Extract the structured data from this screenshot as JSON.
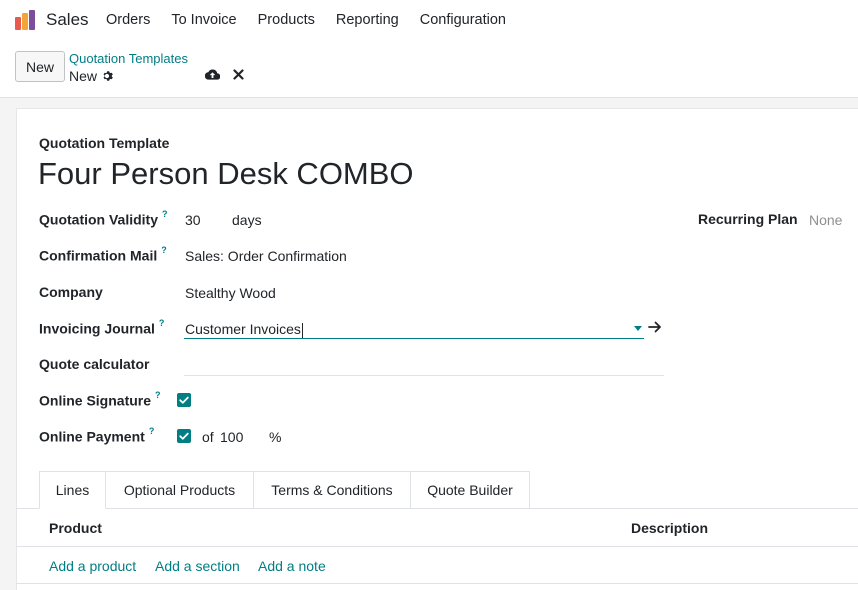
{
  "app": {
    "name": "Sales"
  },
  "nav": {
    "items": [
      "Orders",
      "To Invoice",
      "Products",
      "Reporting",
      "Configuration"
    ]
  },
  "control_panel": {
    "new_label": "New",
    "breadcrumb_parent": "Quotation Templates",
    "breadcrumb_current": "New"
  },
  "form": {
    "title_label": "Quotation Template",
    "title": "Four Person Desk COMBO",
    "fields": {
      "validity": {
        "label": "Quotation Validity",
        "help": "?",
        "value": "30",
        "unit": "days"
      },
      "recurring": {
        "label": "Recurring Plan",
        "value": "None"
      },
      "confirmation_mail": {
        "label": "Confirmation Mail",
        "help": "?",
        "value": "Sales: Order Confirmation"
      },
      "company": {
        "label": "Company",
        "value": "Stealthy Wood"
      },
      "invoicing_journal": {
        "label": "Invoicing Journal",
        "help": "?",
        "value": "Customer Invoices"
      },
      "quote_calculator": {
        "label": "Quote calculator",
        "value": ""
      },
      "online_signature": {
        "label": "Online Signature",
        "help": "?",
        "checked": true
      },
      "online_payment": {
        "label": "Online Payment",
        "help": "?",
        "checked": true,
        "of_label": "of",
        "percent": "100",
        "percent_sign": "%"
      }
    }
  },
  "tabs": [
    "Lines",
    "Optional Products",
    "Terms & Conditions",
    "Quote Builder"
  ],
  "lines_table": {
    "columns": [
      "Product",
      "Description"
    ],
    "actions": [
      "Add a product",
      "Add a section",
      "Add a note"
    ]
  },
  "colors": {
    "accent": "#017e84",
    "text": "#212529"
  }
}
